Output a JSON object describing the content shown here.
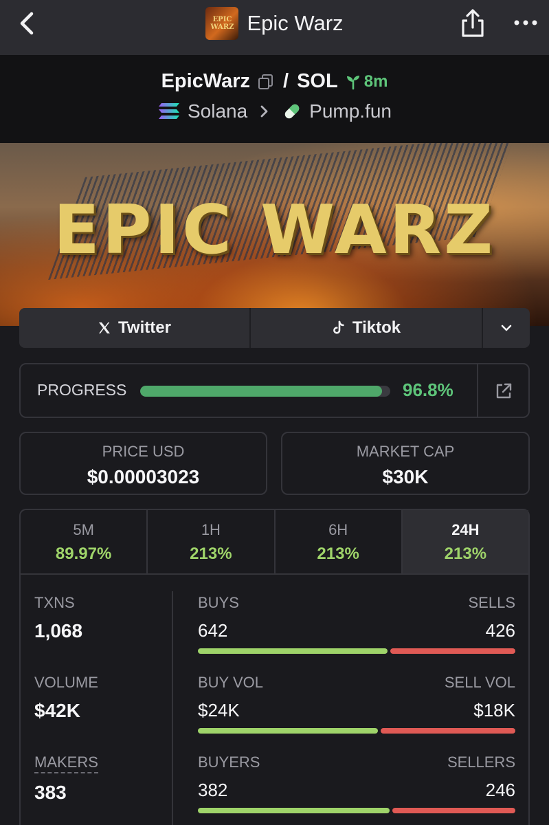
{
  "topbar": {
    "title": "Epic Warz",
    "logo_text": [
      "EPIC",
      "WARZ"
    ]
  },
  "pair": {
    "token": "EpicWarz",
    "quote": "SOL",
    "age": "8m",
    "chain": "Solana",
    "dex": "Pump.fun"
  },
  "banner": {
    "title": "EPIC WARZ"
  },
  "socials": {
    "twitter": "Twitter",
    "tiktok": "Tiktok"
  },
  "progress": {
    "label": "PROGRESS",
    "value_text": "96.8%",
    "fraction": 0.968
  },
  "stats": {
    "price_label": "PRICE USD",
    "price_value": "$0.00003023",
    "mcap_label": "MARKET CAP",
    "mcap_value": "$30K"
  },
  "timeframes": [
    {
      "name": "5M",
      "change": "89.97%"
    },
    {
      "name": "1H",
      "change": "213%"
    },
    {
      "name": "6H",
      "change": "213%"
    },
    {
      "name": "24H",
      "change": "213%",
      "active": true
    }
  ],
  "metrics": {
    "txns": {
      "label": "TXNS",
      "value": "1,068"
    },
    "volume": {
      "label": "VOLUME",
      "value": "$42K"
    },
    "makers": {
      "label": "MAKERS",
      "value": "383"
    },
    "buys_sells": {
      "left_label": "BUYS",
      "right_label": "SELLS",
      "left_value": "642",
      "right_value": "426",
      "left_amount": 642,
      "right_amount": 426
    },
    "buy_sell_vol": {
      "left_label": "BUY VOL",
      "right_label": "SELL VOL",
      "left_value": "$24K",
      "right_value": "$18K",
      "left_amount": 24,
      "right_amount": 18
    },
    "buyers_sellers": {
      "left_label": "BUYERS",
      "right_label": "SELLERS",
      "left_value": "382",
      "right_value": "246",
      "left_amount": 382,
      "right_amount": 246
    }
  },
  "colors": {
    "positive": "#9fd46a",
    "negative": "#e05a55",
    "progress": "#4fa86a",
    "age": "#5ec57a"
  },
  "icons": {
    "back": "chevron-left-icon",
    "share": "share-icon",
    "more": "more-horizontal-icon",
    "copy": "copy-icon",
    "age": "seedling-icon",
    "chain": "solana-icon",
    "chevron": "chevron-right-icon",
    "dex": "pill-icon",
    "twitter": "x-logo-icon",
    "tiktok": "tiktok-icon",
    "expand": "chevron-down-icon",
    "external": "external-link-icon"
  }
}
